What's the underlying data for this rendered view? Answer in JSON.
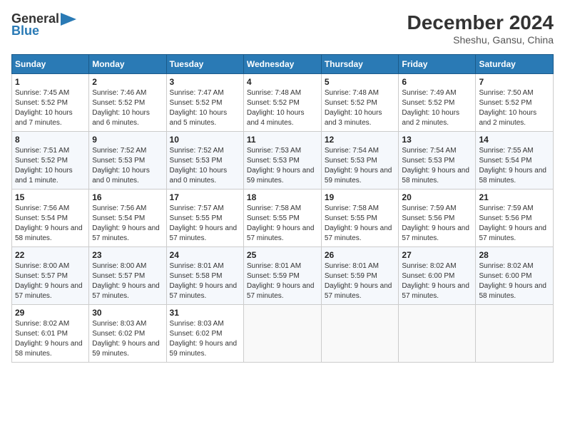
{
  "header": {
    "logo_line1": "General",
    "logo_line2": "Blue",
    "month_title": "December 2024",
    "location": "Sheshu, Gansu, China"
  },
  "days_of_week": [
    "Sunday",
    "Monday",
    "Tuesday",
    "Wednesday",
    "Thursday",
    "Friday",
    "Saturday"
  ],
  "weeks": [
    [
      {
        "day": "1",
        "sunrise": "7:45 AM",
        "sunset": "5:52 PM",
        "daylight": "10 hours and 7 minutes."
      },
      {
        "day": "2",
        "sunrise": "7:46 AM",
        "sunset": "5:52 PM",
        "daylight": "10 hours and 6 minutes."
      },
      {
        "day": "3",
        "sunrise": "7:47 AM",
        "sunset": "5:52 PM",
        "daylight": "10 hours and 5 minutes."
      },
      {
        "day": "4",
        "sunrise": "7:48 AM",
        "sunset": "5:52 PM",
        "daylight": "10 hours and 4 minutes."
      },
      {
        "day": "5",
        "sunrise": "7:48 AM",
        "sunset": "5:52 PM",
        "daylight": "10 hours and 3 minutes."
      },
      {
        "day": "6",
        "sunrise": "7:49 AM",
        "sunset": "5:52 PM",
        "daylight": "10 hours and 2 minutes."
      },
      {
        "day": "7",
        "sunrise": "7:50 AM",
        "sunset": "5:52 PM",
        "daylight": "10 hours and 2 minutes."
      }
    ],
    [
      {
        "day": "8",
        "sunrise": "7:51 AM",
        "sunset": "5:52 PM",
        "daylight": "10 hours and 1 minute."
      },
      {
        "day": "9",
        "sunrise": "7:52 AM",
        "sunset": "5:53 PM",
        "daylight": "10 hours and 0 minutes."
      },
      {
        "day": "10",
        "sunrise": "7:52 AM",
        "sunset": "5:53 PM",
        "daylight": "10 hours and 0 minutes."
      },
      {
        "day": "11",
        "sunrise": "7:53 AM",
        "sunset": "5:53 PM",
        "daylight": "9 hours and 59 minutes."
      },
      {
        "day": "12",
        "sunrise": "7:54 AM",
        "sunset": "5:53 PM",
        "daylight": "9 hours and 59 minutes."
      },
      {
        "day": "13",
        "sunrise": "7:54 AM",
        "sunset": "5:53 PM",
        "daylight": "9 hours and 58 minutes."
      },
      {
        "day": "14",
        "sunrise": "7:55 AM",
        "sunset": "5:54 PM",
        "daylight": "9 hours and 58 minutes."
      }
    ],
    [
      {
        "day": "15",
        "sunrise": "7:56 AM",
        "sunset": "5:54 PM",
        "daylight": "9 hours and 58 minutes."
      },
      {
        "day": "16",
        "sunrise": "7:56 AM",
        "sunset": "5:54 PM",
        "daylight": "9 hours and 57 minutes."
      },
      {
        "day": "17",
        "sunrise": "7:57 AM",
        "sunset": "5:55 PM",
        "daylight": "9 hours and 57 minutes."
      },
      {
        "day": "18",
        "sunrise": "7:58 AM",
        "sunset": "5:55 PM",
        "daylight": "9 hours and 57 minutes."
      },
      {
        "day": "19",
        "sunrise": "7:58 AM",
        "sunset": "5:55 PM",
        "daylight": "9 hours and 57 minutes."
      },
      {
        "day": "20",
        "sunrise": "7:59 AM",
        "sunset": "5:56 PM",
        "daylight": "9 hours and 57 minutes."
      },
      {
        "day": "21",
        "sunrise": "7:59 AM",
        "sunset": "5:56 PM",
        "daylight": "9 hours and 57 minutes."
      }
    ],
    [
      {
        "day": "22",
        "sunrise": "8:00 AM",
        "sunset": "5:57 PM",
        "daylight": "9 hours and 57 minutes."
      },
      {
        "day": "23",
        "sunrise": "8:00 AM",
        "sunset": "5:57 PM",
        "daylight": "9 hours and 57 minutes."
      },
      {
        "day": "24",
        "sunrise": "8:01 AM",
        "sunset": "5:58 PM",
        "daylight": "9 hours and 57 minutes."
      },
      {
        "day": "25",
        "sunrise": "8:01 AM",
        "sunset": "5:59 PM",
        "daylight": "9 hours and 57 minutes."
      },
      {
        "day": "26",
        "sunrise": "8:01 AM",
        "sunset": "5:59 PM",
        "daylight": "9 hours and 57 minutes."
      },
      {
        "day": "27",
        "sunrise": "8:02 AM",
        "sunset": "6:00 PM",
        "daylight": "9 hours and 57 minutes."
      },
      {
        "day": "28",
        "sunrise": "8:02 AM",
        "sunset": "6:00 PM",
        "daylight": "9 hours and 58 minutes."
      }
    ],
    [
      {
        "day": "29",
        "sunrise": "8:02 AM",
        "sunset": "6:01 PM",
        "daylight": "9 hours and 58 minutes."
      },
      {
        "day": "30",
        "sunrise": "8:03 AM",
        "sunset": "6:02 PM",
        "daylight": "9 hours and 59 minutes."
      },
      {
        "day": "31",
        "sunrise": "8:03 AM",
        "sunset": "6:02 PM",
        "daylight": "9 hours and 59 minutes."
      },
      null,
      null,
      null,
      null
    ]
  ]
}
